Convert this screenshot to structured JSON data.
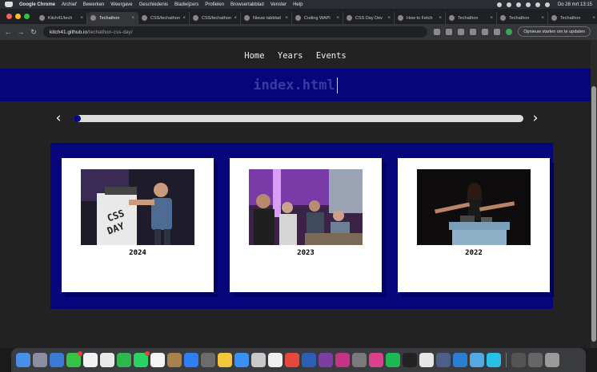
{
  "menubar": {
    "app_name": "Google Chrome",
    "items": [
      "Archief",
      "Bewerken",
      "Weergave",
      "Geschiedenis",
      "Bladwijzers",
      "Profielen",
      "Browsertabblad",
      "Venster",
      "Help"
    ],
    "clock": "Do 28 mrt 13:15"
  },
  "tabs": [
    {
      "label": "Kitch41/tech",
      "active": false
    },
    {
      "label": "Techathon",
      "active": true
    },
    {
      "label": "CSS/techathon",
      "active": false
    },
    {
      "label": "CSS/techathon",
      "active": false
    },
    {
      "label": "Nieuw tabblad",
      "active": false
    },
    {
      "label": "Coding WAPI",
      "active": false
    },
    {
      "label": "CSS Day Dev",
      "active": false
    },
    {
      "label": "How to Fetch",
      "active": false
    },
    {
      "label": "Techathon",
      "active": false
    },
    {
      "label": "Techathon",
      "active": false
    },
    {
      "label": "Techathon",
      "active": false
    }
  ],
  "address": {
    "host": "kitch41.github.io",
    "path": "/techathon-css-day/",
    "update_button": "Opnieuw starten om te updaten"
  },
  "site": {
    "nav": [
      "Home",
      "Years",
      "Events"
    ],
    "title": "index.html",
    "timeline": {
      "prev": "‹",
      "next": "›",
      "progress": 0.0
    },
    "cards": [
      {
        "year": "2024",
        "photo": "speaker-at-css-day-logo-podium"
      },
      {
        "year": "2023",
        "photo": "audience-with-purple-lights"
      },
      {
        "year": "2022",
        "photo": "speaker-arms-spread-on-stage"
      }
    ]
  },
  "colors": {
    "brand_blue": "#07057c",
    "page_bg": "#222222",
    "card_bg": "#ffffff"
  }
}
